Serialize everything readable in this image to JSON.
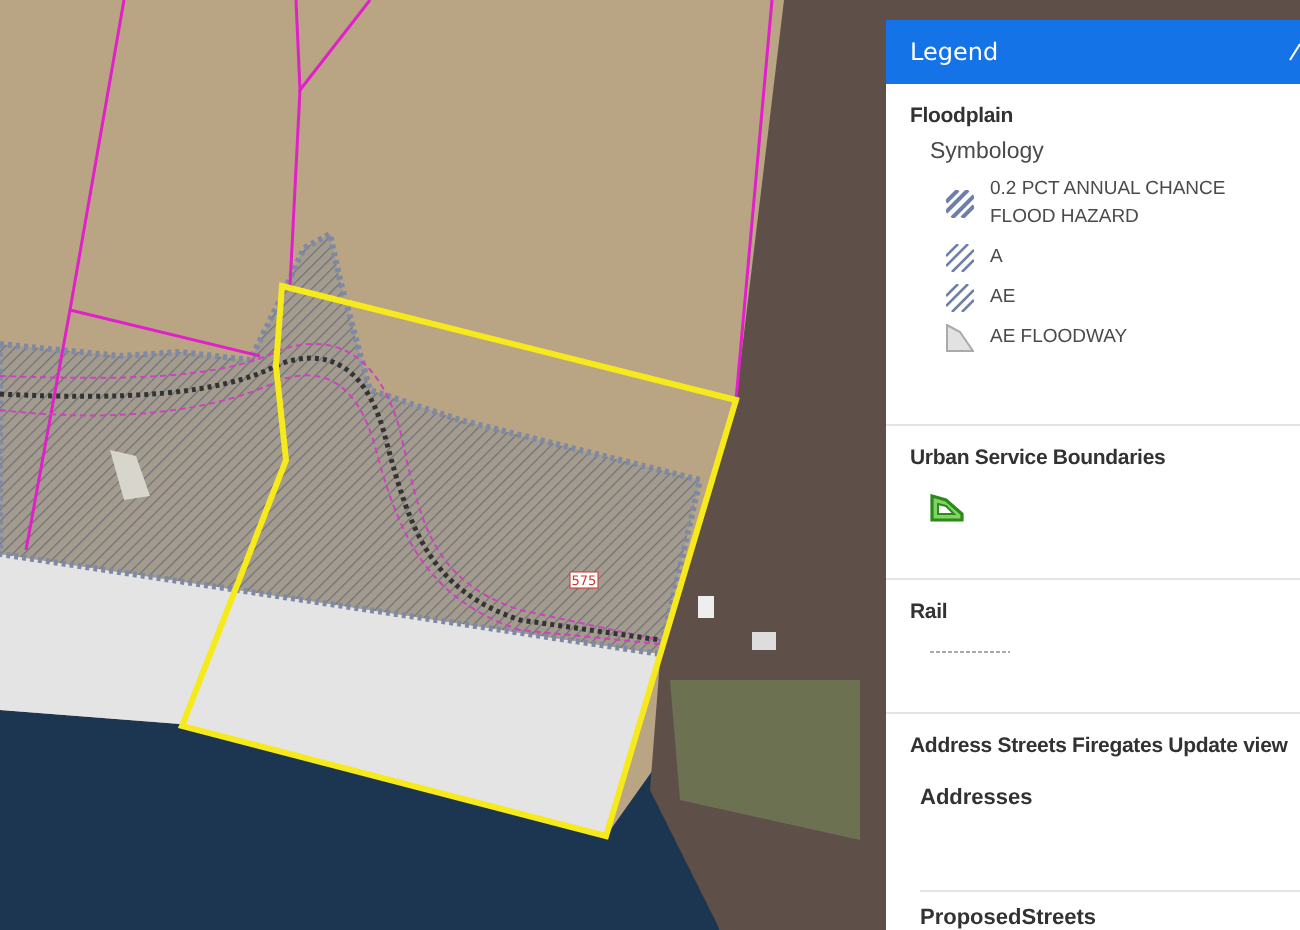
{
  "map": {
    "parcel_label": "575"
  },
  "legend": {
    "title": "Legend",
    "layers": [
      {
        "name": "Floodplain",
        "kind": "grouped",
        "groups": [
          {
            "name": "Symbology",
            "items": [
              {
                "label": "0.2 PCT ANNUAL CHANCE FLOOD HAZARD",
                "kind": "hatch-dense"
              },
              {
                "label": "A",
                "kind": "hatch"
              },
              {
                "label": "AE",
                "kind": "hatch"
              },
              {
                "label": "AE FLOODWAY",
                "kind": "fill"
              }
            ]
          }
        ]
      },
      {
        "name": "Urban Service Boundaries",
        "kind": "polygon-symbol"
      },
      {
        "name": "Rail",
        "kind": "line-symbol"
      },
      {
        "name": "Address Streets Firegates Update view",
        "kind": "sublayers",
        "sublayers": [
          "Addresses",
          "ProposedStreets"
        ]
      }
    ]
  }
}
